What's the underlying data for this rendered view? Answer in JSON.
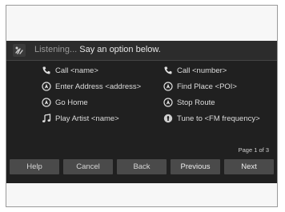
{
  "header": {
    "status": "Listening...",
    "prompt": "Say an option below."
  },
  "commands": [
    {
      "label": "Call <name>",
      "icon": "phone-icon"
    },
    {
      "label": "Call <number>",
      "icon": "phone-icon"
    },
    {
      "label": "Enter Address <address>",
      "icon": "navigation-icon"
    },
    {
      "label": "Find Place <POI>",
      "icon": "navigation-icon"
    },
    {
      "label": "Go Home",
      "icon": "navigation-icon"
    },
    {
      "label": "Stop Route",
      "icon": "navigation-icon"
    },
    {
      "label": "Play Artist <name>",
      "icon": "music-note-icon"
    },
    {
      "label": "Tune to <FM frequency>",
      "icon": "radio-icon"
    }
  ],
  "page_indicator": "Page 1 of 3",
  "buttons": {
    "help": "Help",
    "cancel": "Cancel",
    "back": "Back",
    "previous": "Previous",
    "next": "Next"
  }
}
